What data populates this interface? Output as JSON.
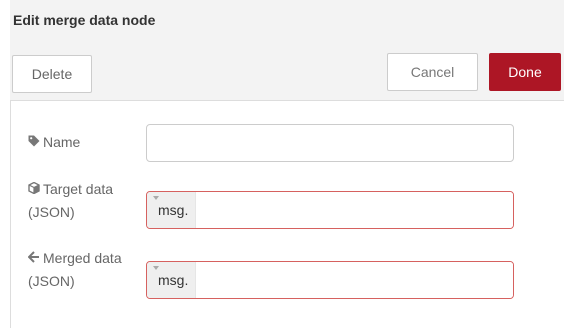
{
  "dialog": {
    "title": "Edit merge data node"
  },
  "toolbar": {
    "delete_label": "Delete",
    "cancel_label": "Cancel",
    "done_label": "Done"
  },
  "form": {
    "name": {
      "label": "Name",
      "value": "",
      "icon": "tag-icon"
    },
    "target": {
      "label_line1": "Target data",
      "label_line2": "(JSON)",
      "type_prefix": "msg.",
      "value": "",
      "icon": "cube-icon"
    },
    "merged": {
      "label_line1": "Merged data",
      "label_line2": "(JSON)",
      "type_prefix": "msg.",
      "value": "",
      "icon": "arrow-left-icon"
    }
  },
  "colors": {
    "done_button": "#ad1625",
    "invalid_border": "#d6615f",
    "header_background": "#f3f3f3"
  }
}
